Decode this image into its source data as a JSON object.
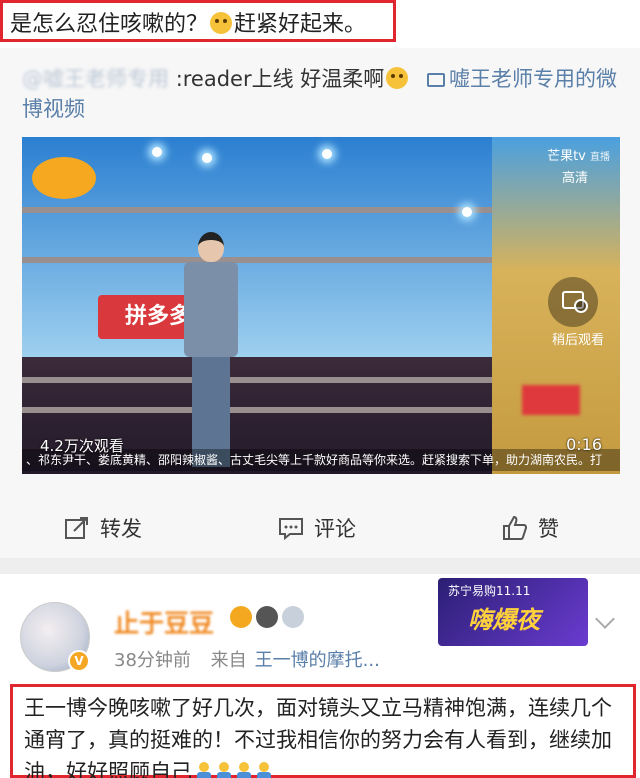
{
  "top_comment": {
    "text_before": "是怎么忍住咳嗽的？",
    "text_after": "赶紧好起来。"
  },
  "repost": {
    "author_handle": "@嘘王老师专用",
    "text": ":reader上线 好温柔啊",
    "video_link_label": "嘘王老师专用的微博视频"
  },
  "video": {
    "brand": "芒果tv",
    "brand_sub": "直播",
    "quality": "高清",
    "banner_text": "拼多多",
    "watch_later_label": "稍后观看",
    "views": "4.2万次观看",
    "duration": "0:16",
    "ticker": "、祁东尹干、娄底黄精、邵阳辣椒酱、古丈毛尖等上千款好商品等你来选。赶紧搜索下单，助力湖南农民。打"
  },
  "actions": {
    "repost_label": "转发",
    "comment_label": "评论",
    "like_label": "赞"
  },
  "comment": {
    "username": "止于豆豆",
    "time": "38分钟前",
    "source_prefix": "来自",
    "source": "王一博的摩托...",
    "text": "王一博今晚咳嗽了好几次，面对镜头又立马精神饱满，连续几个通宵了，真的挺难的！不过我相信你的努力会有人看到，继续加油，好好照顾自己",
    "promo_top": "苏宁易购11.11",
    "promo_main": "嗨爆夜"
  },
  "colors": {
    "highlight_red": "#e0262e",
    "link_blue": "#5a7fa8",
    "username_orange": "#f08a24"
  }
}
